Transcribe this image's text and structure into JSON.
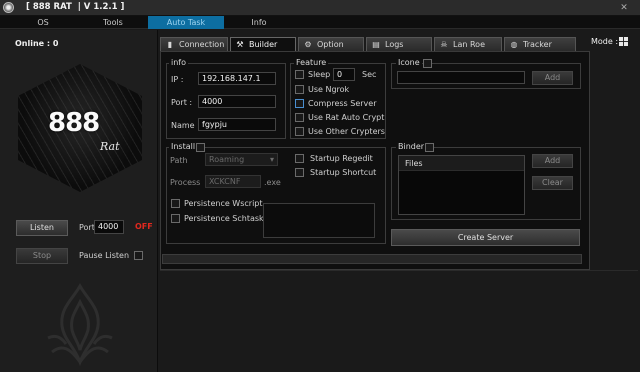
{
  "window": {
    "title": "[ 888 RAT  | V 1.2.1 ]"
  },
  "menu": {
    "items": [
      "OS",
      "Tools",
      "Auto Task",
      "Info"
    ],
    "active": "Auto Task"
  },
  "sidebar": {
    "online_label": "Online : 0",
    "logo_text": "888",
    "logo_sub": "Rat",
    "listen_label": "Listen",
    "port_label": "Port",
    "port_value": "4000",
    "status": "OFF",
    "stop_label": "Stop",
    "pause_label": "Pause Listen"
  },
  "tabs": {
    "items": [
      {
        "label": "Connection",
        "icon": "connection-icon"
      },
      {
        "label": "Builder",
        "icon": "tools-icon"
      },
      {
        "label": "Option",
        "icon": "gear-icon"
      },
      {
        "label": "Logs",
        "icon": "logs-icon"
      },
      {
        "label": "Lan Roe",
        "icon": "skull-icon"
      },
      {
        "label": "Tracker",
        "icon": "globe-icon"
      }
    ],
    "active": "Builder",
    "mode_label": "Mode :"
  },
  "builder": {
    "info": {
      "title": "info",
      "ip_label": "IP :",
      "ip_value": "192.168.147.1",
      "port_label": "Port :",
      "port_value": "4000",
      "name_label": "Name :",
      "name_value": "fgypju"
    },
    "feature": {
      "title": "Feature",
      "sleep_label": "Sleep",
      "sleep_value": "0",
      "sleep_unit": "Sec",
      "options": [
        "Use Ngrok",
        "Compress Server",
        "Use Rat Auto Crypt",
        "Use Other Crypters"
      ]
    },
    "icone": {
      "title": "Icone",
      "add_label": "Add"
    },
    "install": {
      "title": "Install",
      "path_label": "Path",
      "path_value": "Roaming",
      "process_label": "Process",
      "process_value": "XCKCNF",
      "process_ext": ".exe",
      "startup_regedit": "Startup Regedit",
      "startup_shortcut": "Startup Shortcut",
      "persistence_wscript": "Persistence Wscript",
      "persistence_schtasks": "Persistence Schtasks"
    },
    "binder": {
      "title": "Binder",
      "files_header": "Files",
      "add_label": "Add",
      "clear_label": "Clear"
    },
    "create_label": "Create Server",
    "progress": 0
  },
  "colors": {
    "accent": "#0d6ea1",
    "status_off": "#e0281e",
    "background": "#1a1a1a"
  }
}
